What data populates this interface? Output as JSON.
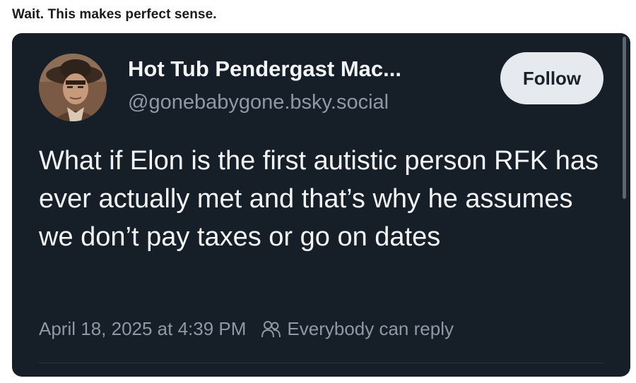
{
  "caption": "Wait. This makes perfect sense.",
  "post": {
    "author_name": "Hot Tub Pendergast Mac...",
    "author_handle": "@gonebabygone.bsky.social",
    "follow_label": "Follow",
    "text": "What if Elon is the first autistic person RFK has ever actually met and that’s why he assumes we don’t pay taxes or go on dates",
    "timestamp": "April 18, 2025 at 4:39 PM",
    "reply_setting": "Everybody can reply",
    "reply_icon": "people-icon"
  },
  "colors": {
    "card_background": "#161e27",
    "primary_text": "#f2f4f6",
    "secondary_text": "#8e99a6",
    "follow_button_bg": "#e6e9ee"
  }
}
